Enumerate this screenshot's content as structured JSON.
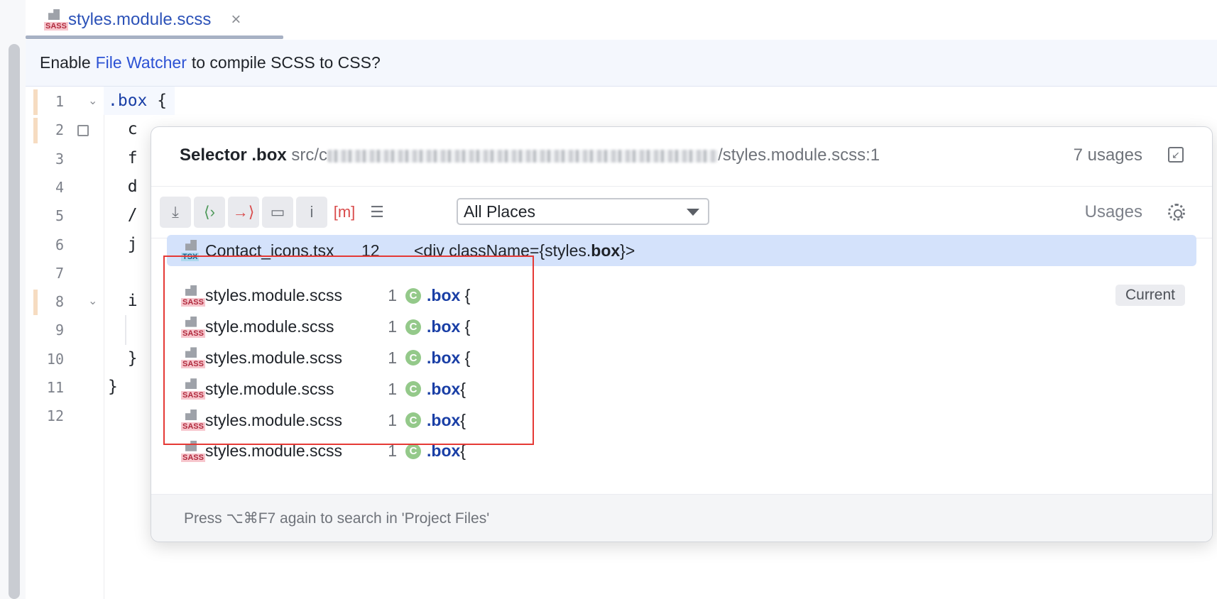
{
  "tab": {
    "title": "styles.module.scss",
    "close_glyph": "×",
    "icon": "sass-file-icon"
  },
  "notification": {
    "prefix": "Enable",
    "link": "File Watcher",
    "suffix": "to compile SCSS to CSS?"
  },
  "editor": {
    "line_numbers": [
      "1",
      "2",
      "3",
      "4",
      "5",
      "6",
      "7",
      "8",
      "9",
      "10",
      "11",
      "12"
    ],
    "lines": [
      {
        "pre": "",
        "sel": ".box",
        "post": " {"
      },
      {
        "pre": "  c",
        "sel": "",
        "post": ""
      },
      {
        "pre": "  f",
        "sel": "",
        "post": ""
      },
      {
        "pre": "  d",
        "sel": "",
        "post": ""
      },
      {
        "pre": "  /",
        "sel": "",
        "post": ""
      },
      {
        "pre": "  j",
        "sel": "",
        "post": ""
      },
      {
        "pre": "",
        "sel": "",
        "post": ""
      },
      {
        "pre": "  i",
        "sel": "",
        "post": ""
      },
      {
        "pre": "",
        "sel": "",
        "post": ""
      },
      {
        "pre": "  }",
        "sel": "",
        "post": ""
      },
      {
        "pre": "}",
        "sel": "",
        "post": ""
      },
      {
        "pre": "",
        "sel": "",
        "post": ""
      }
    ]
  },
  "popup": {
    "title_bold": "Selector .box",
    "path_prefix": "src/c",
    "path_suffix": "/styles.module.scss:1",
    "usage_count": "7 usages",
    "scope": "All Places",
    "usages_label": "Usages",
    "toolbar_icons": [
      "expand-all-icon",
      "navigate-in-icon",
      "navigate-out-icon",
      "folder-settings-icon",
      "info-icon",
      "merge-icon",
      "preview-icon"
    ],
    "info_glyph": "i",
    "merge_glyph": "[m]",
    "results": [
      {
        "icon": "tsx",
        "file": "Contact_icons.tsx",
        "line": "12",
        "snippet_pre": "<div className={styles.",
        "snippet_bold": "box",
        "snippet_post": "}>"
      },
      {
        "icon": "sass",
        "file": "styles.module.scss",
        "line": "1",
        "badge": "C",
        "code_kw": ".box",
        "code_post": " {",
        "current": "Current"
      },
      {
        "icon": "sass",
        "file": "style.module.scss",
        "line": "1",
        "badge": "C",
        "code_kw": ".box",
        "code_post": " {"
      },
      {
        "icon": "sass",
        "file": "styles.module.scss",
        "line": "1",
        "badge": "C",
        "code_kw": ".box",
        "code_post": " {"
      },
      {
        "icon": "sass",
        "file": "style.module.scss",
        "line": "1",
        "badge": "C",
        "code_kw": ".box",
        "code_post": "{"
      },
      {
        "icon": "sass",
        "file": "styles.module.scss",
        "line": "1",
        "badge": "C",
        "code_kw": ".box",
        "code_post": "{"
      },
      {
        "icon": "sass",
        "file": "styles.module.scss",
        "line": "1",
        "badge": "C",
        "code_kw": ".box",
        "code_post": "{"
      }
    ],
    "footer": "Press ⌥⌘F7 again to search in 'Project Files'"
  },
  "icon_tags": {
    "sass": "SASS",
    "tsx": "TSX"
  },
  "colors": {
    "accent": "#2c52d4",
    "selection": "#d4e2fb",
    "highlight_box": "#e53935",
    "class_badge": "#94c98a"
  }
}
